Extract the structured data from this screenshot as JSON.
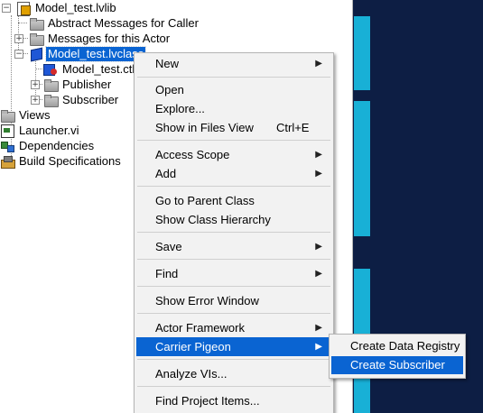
{
  "tree": {
    "items": [
      {
        "label": "Model_test.lvlib",
        "icon": "lvlib-icon"
      },
      {
        "label": "Abstract Messages for Caller",
        "icon": "folder-icon"
      },
      {
        "label": "Messages for this Actor",
        "icon": "folder-icon"
      },
      {
        "label": "Model_test.lvclass",
        "icon": "lvclass-icon"
      },
      {
        "label": "Model_test.ctl",
        "icon": "ctl-icon"
      },
      {
        "label": "Publisher",
        "icon": "folder-icon"
      },
      {
        "label": "Subscriber",
        "icon": "folder-icon"
      },
      {
        "label": "Views",
        "icon": "folder-icon"
      },
      {
        "label": "Launcher.vi",
        "icon": "vi-icon"
      },
      {
        "label": "Dependencies",
        "icon": "dependencies-icon"
      },
      {
        "label": "Build Specifications",
        "icon": "build-icon"
      }
    ]
  },
  "context_menu": {
    "items": [
      {
        "label": "New",
        "submenu": true
      },
      {
        "label": "Open"
      },
      {
        "label": "Explore..."
      },
      {
        "label": "Show in Files View",
        "shortcut": "Ctrl+E"
      },
      {
        "label": "Access Scope",
        "submenu": true
      },
      {
        "label": "Add",
        "submenu": true
      },
      {
        "label": "Go to Parent Class"
      },
      {
        "label": "Show Class Hierarchy"
      },
      {
        "label": "Save",
        "submenu": true
      },
      {
        "label": "Find",
        "submenu": true
      },
      {
        "label": "Show Error Window"
      },
      {
        "label": "Actor Framework",
        "submenu": true
      },
      {
        "label": "Carrier Pigeon",
        "submenu": true,
        "highlighted": true
      },
      {
        "label": "Analyze VIs..."
      },
      {
        "label": "Find Project Items..."
      }
    ],
    "submenu_arrow": "▶"
  },
  "submenu": {
    "items": [
      {
        "label": "Create Data Registry"
      },
      {
        "label": "Create Subscriber",
        "highlighted": true
      }
    ]
  },
  "colors": {
    "selection": "#0a64d2",
    "menu_background": "#f2f2f2",
    "dark_pane": "#0d1e44",
    "accent_strip": "#18b0d6"
  }
}
